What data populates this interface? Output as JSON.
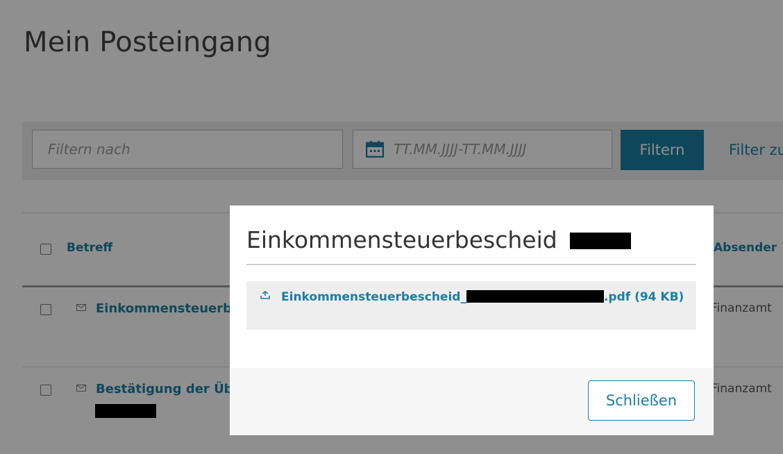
{
  "page": {
    "title": "Mein Posteingang"
  },
  "filter": {
    "search_placeholder": "Filtern nach",
    "date_placeholder": "TT.MM.JJJJ-TT.MM.JJJJ",
    "filter_button": "Filtern",
    "reset_link": "Filter zu"
  },
  "table": {
    "headers": {
      "subject": "Betreff",
      "sender": "Absender"
    },
    "rows": [
      {
        "subject": "Einkommensteuerb",
        "sender": "Finanzamt"
      },
      {
        "subject": "Bestätigung der Üb",
        "sender": "Finanzamt"
      }
    ]
  },
  "modal": {
    "title": "Einkommensteuerbescheid",
    "attachment_prefix": "Einkommensteuerbescheid_",
    "attachment_suffix": ".pdf (94 KB)",
    "close_button": "Schließen"
  },
  "colors": {
    "accent": "#1a7fa3",
    "overlay": "rgba(0,0,0,0.44)",
    "redaction": "#000000"
  },
  "icons": {
    "date": "calendar-icon",
    "mail": "envelope-icon",
    "download": "download-icon"
  }
}
